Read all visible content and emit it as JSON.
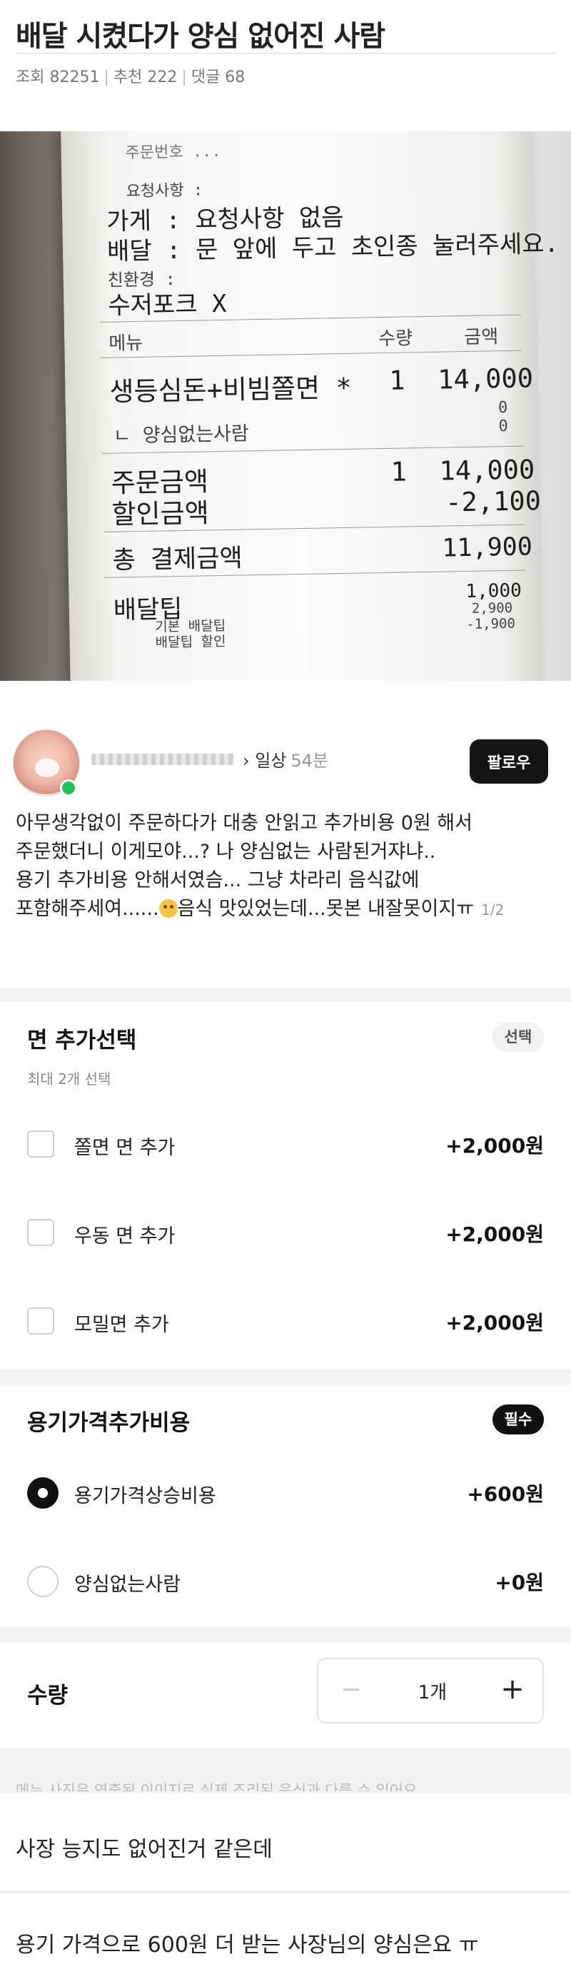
{
  "post": {
    "title": "배달 시켰다가 양심 없어진 사람",
    "meta": {
      "views": "조회 82251",
      "recommends": "추천 222",
      "comments": "댓글 68"
    }
  },
  "receipt": {
    "top_scribble": "주문번호 ...",
    "request_header": "요청사항 :",
    "store_request": "가게 : 요청사항 없음",
    "delivery_request": "배달 : 문 앞에 두고 초인종 눌러주세요.",
    "eco_header": "친환경 :",
    "eco_value": "수저포크 X",
    "col_menu": "메뉴",
    "col_qty": "수량",
    "col_amount": "금액",
    "item_name": "생등심돈+비빔쫄면 *",
    "item_qty": "1",
    "item_amount": "14,000",
    "zero_a": "0",
    "sub_item": "ㄴ 양심없는사람",
    "zero_b": "0",
    "order_total_label": "주문금액",
    "order_total_qty": "1",
    "order_total_value": "14,000",
    "discount_label": "할인금액",
    "discount_value": "-2,100",
    "pay_total_label": "총 결제금액",
    "pay_total_value": "11,900",
    "delivery_tip_label": "배달팁",
    "delivery_tip_value": "1,000",
    "basic_tip_label": "기본 배달팁",
    "basic_tip_value": "2,900",
    "tip_discount_label": "배달팁 할인",
    "tip_discount_value": "-1,900"
  },
  "author": {
    "category": "› 일상",
    "time": "54분",
    "follow_label": "팔로우"
  },
  "body": {
    "line1": "아무생각없이 주문하다가 대충 안읽고 추가비용 0원 해서",
    "line2": "주문했더니 이게모야...? 나 양심없는 사람된거쟈냐..",
    "line3": "용기 추가비용 안해서였슴... 그냥 차라리 음식값에",
    "line4a": "포함해주세여......",
    "line4b": "음식 맛있었는데...못본 내잘못이지ㅠ",
    "page_indicator": "1/2"
  },
  "noodle_section": {
    "title": "면 추가선택",
    "subtitle": "최대 2개 선택",
    "badge": "선택",
    "options": [
      {
        "label": "쫄면 면 추가",
        "price": "+2,000원"
      },
      {
        "label": "우동 면 추가",
        "price": "+2,000원"
      },
      {
        "label": "모밀면 추가",
        "price": "+2,000원"
      }
    ]
  },
  "container_section": {
    "title": "용기가격추가비용",
    "badge": "필수",
    "options": [
      {
        "label": "용기가격상승비용",
        "price": "+600원",
        "selected": true
      },
      {
        "label": "양심없는사람",
        "price": "+0원",
        "selected": false
      }
    ]
  },
  "quantity": {
    "label": "수량",
    "value": "1개",
    "minus": "−",
    "plus": "+"
  },
  "notice": "메뉴 사진은 연출된 이미지로 실제 조리된 음식과 다를 수 있어요",
  "comments": [
    "사장 능지도 없어진거 같은데",
    "용기 가격으로 600원 더 받는 사장님의 양심은요 ㅠ"
  ]
}
